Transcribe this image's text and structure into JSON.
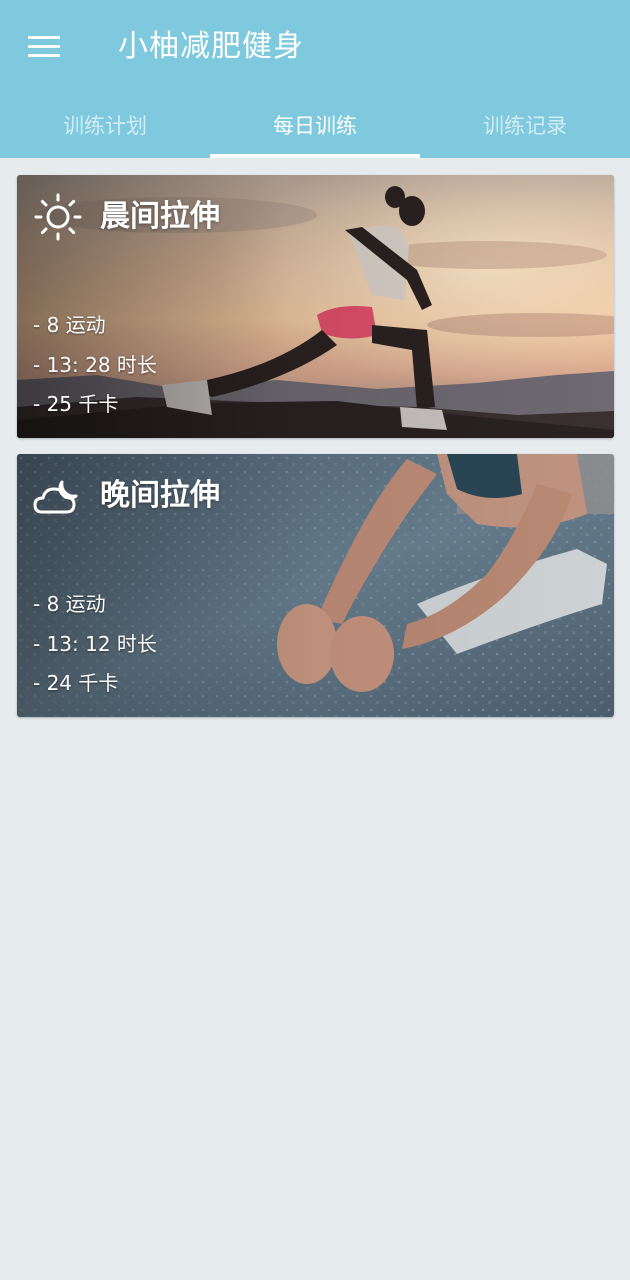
{
  "app": {
    "title": "小柚减肥健身"
  },
  "colors": {
    "appbar": "#7ec9de",
    "background": "#e6ebee",
    "text_on_accent": "#ffffff"
  },
  "header": {
    "menu_icon": "hamburger-menu-icon"
  },
  "tabs": [
    {
      "label": "训练计划",
      "active": false
    },
    {
      "label": "每日训练",
      "active": true
    },
    {
      "label": "训练记录",
      "active": false
    }
  ],
  "workouts": [
    {
      "title": "晨间拉伸",
      "icon": "sun-icon",
      "stats": [
        "- 8 运动",
        "- 13: 28 时长",
        "- 25 千卡"
      ]
    },
    {
      "title": "晚间拉伸",
      "icon": "cloud-moon-icon",
      "stats": [
        "- 8 运动",
        "- 13: 12 时长",
        "- 24 千卡"
      ]
    }
  ]
}
